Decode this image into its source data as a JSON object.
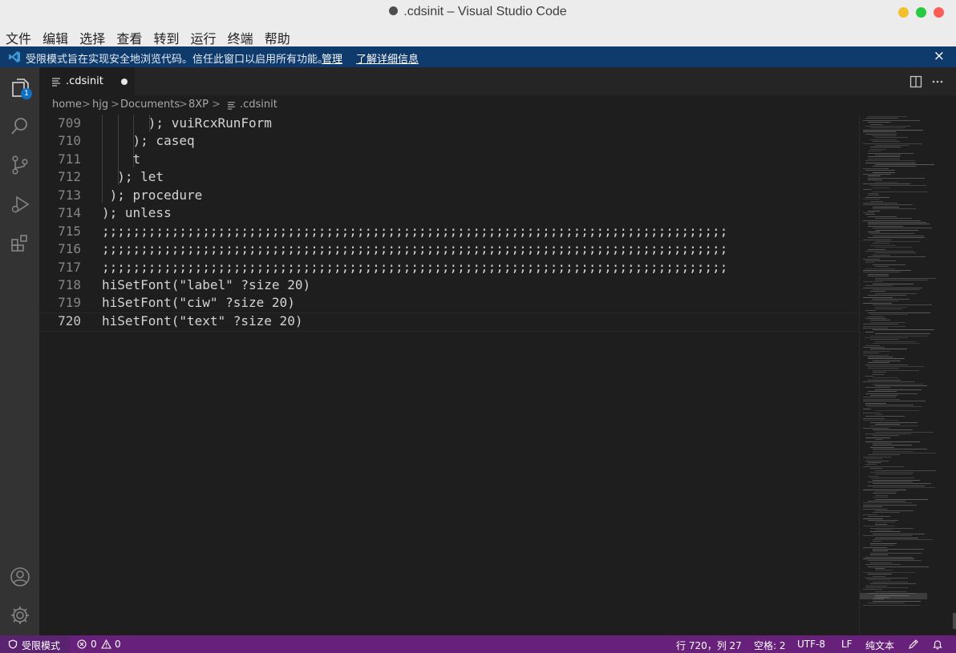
{
  "window": {
    "title": ".cdsinit – Visual Studio Code"
  },
  "menu": [
    "文件",
    "编辑",
    "选择",
    "查看",
    "转到",
    "运行",
    "终端",
    "帮助"
  ],
  "banner": {
    "message": "受限模式旨在实现安全地浏览代码。信任此窗口以启用所有功能。",
    "manage": "管理",
    "learn_more": "了解详细信息",
    "close": "×"
  },
  "activity": {
    "explorer_badge": "1"
  },
  "tab": {
    "label": ".cdsinit"
  },
  "breadcrumb": {
    "items": [
      "home",
      "hjg",
      "Documents",
      "8XP",
      ".cdsinit"
    ],
    "sep": ">"
  },
  "editor": {
    "lines": [
      {
        "num": "709",
        "text": "      ); vuiRcxRunForm"
      },
      {
        "num": "710",
        "text": "    ); caseq"
      },
      {
        "num": "711",
        "text": "    t"
      },
      {
        "num": "712",
        "text": "  ); let"
      },
      {
        "num": "713",
        "text": " ); procedure"
      },
      {
        "num": "714",
        "text": "); unless"
      },
      {
        "num": "715",
        "text": ";;;;;;;;;;;;;;;;;;;;;;;;;;;;;;;;;;;;;;;;;;;;;;;;;;;;;;;;;;;;;;;;;;;;;;;;;;;;;;;;;"
      },
      {
        "num": "716",
        "text": ";;;;;;;;;;;;;;;;;;;;;;;;;;;;;;;;;;;;;;;;;;;;;;;;;;;;;;;;;;;;;;;;;;;;;;;;;;;;;;;;;"
      },
      {
        "num": "717",
        "text": ";;;;;;;;;;;;;;;;;;;;;;;;;;;;;;;;;;;;;;;;;;;;;;;;;;;;;;;;;;;;;;;;;;;;;;;;;;;;;;;;;"
      },
      {
        "num": "718",
        "text": "hiSetFont(\"label\" ?size 20)"
      },
      {
        "num": "719",
        "text": "hiSetFont(\"ciw\" ?size 20)"
      },
      {
        "num": "720",
        "text": "hiSetFont(\"text\" ?size 20)"
      }
    ]
  },
  "status": {
    "restricted": "受限模式",
    "errors": "0",
    "warnings": "0",
    "position": "行 720，列 27",
    "spaces": "空格: 2",
    "encoding": "UTF-8",
    "eol": "LF",
    "language": "纯文本"
  },
  "colors": {
    "status_bar": "#68217a",
    "banner": "#0e3a6c",
    "accent": "#0e70c0"
  }
}
